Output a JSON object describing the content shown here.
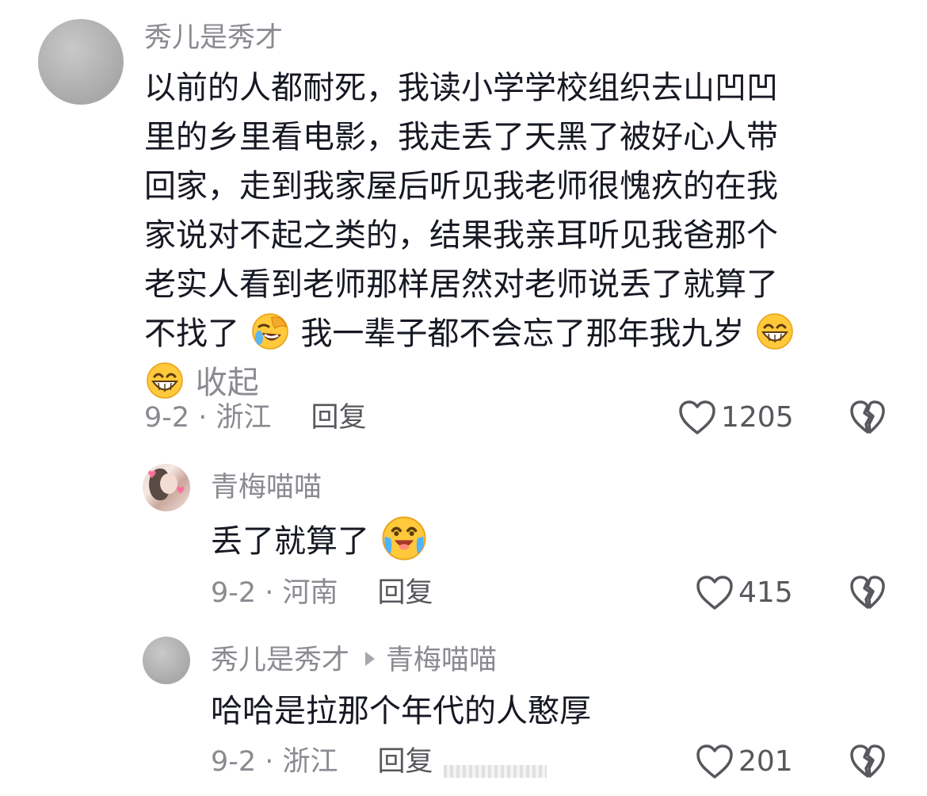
{
  "comments": [
    {
      "username": "秀儿是秀才",
      "lines": [
        "以前的人都耐死，我读小学学校组织去山凹凹",
        "里的乡里看电影，我走丢了天黑了被好心人带",
        "回家，走到我家屋后听见我老师很愧疚的在我",
        "家说对不起之类的，结果我亲耳听见我爸那个",
        "老实人看到老师那样居然对老师说丢了就算了"
      ],
      "line6_a": "不找了",
      "line6_b": "我一辈子都不会忘了那年我九岁",
      "collapse_label": "收起",
      "date_location": "9-2 · 浙江",
      "reply_label": "回复",
      "like_count": "1205",
      "avatar_icon": "gray-avatar",
      "emojis": [
        "facepalm-laugh-emoji",
        "grin-emoji",
        "grin-emoji"
      ]
    },
    {
      "username": "青梅喵喵",
      "text": "丢了就算了",
      "date_location": "9-2 · 河南",
      "reply_label": "回复",
      "like_count": "415",
      "avatar_icon": "photo-avatar",
      "emojis": [
        "laugh-cry-emoji"
      ]
    },
    {
      "username": "秀儿是秀才",
      "reply_to": "青梅喵喵",
      "text": "哈哈是拉那个年代的人憨厚",
      "date_location": "9-2 · 浙江",
      "reply_label": "回复",
      "like_count": "201",
      "avatar_icon": "gray-avatar"
    }
  ],
  "icons": {
    "like": "heart-outline-icon",
    "dislike": "broken-heart-icon",
    "reply_arrow": "play-triangle-icon"
  },
  "colors": {
    "text": "#161823",
    "secondary": "#8a8b91",
    "action": "#57585d",
    "emoji_yellow": "#ffc93b"
  }
}
